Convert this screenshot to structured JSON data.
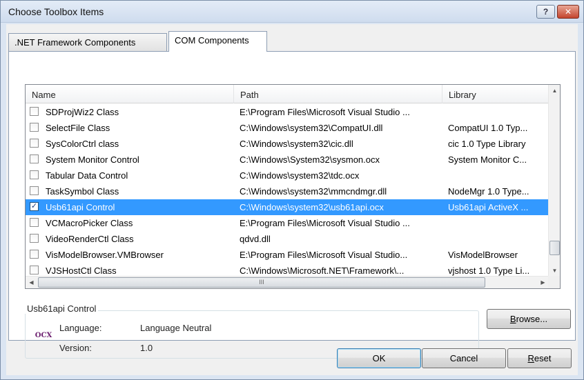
{
  "window": {
    "title": "Choose Toolbox Items",
    "help_button": "?",
    "close_button": "✕"
  },
  "tabs": [
    {
      "label": ".NET Framework Components",
      "active": false
    },
    {
      "label": "COM Components",
      "active": true
    }
  ],
  "columns": {
    "name": "Name",
    "path": "Path",
    "library": "Library"
  },
  "rows": [
    {
      "checked": false,
      "selected": false,
      "name": "SDProjWiz2 Class",
      "path": "E:\\Program Files\\Microsoft Visual Studio ...",
      "library": ""
    },
    {
      "checked": false,
      "selected": false,
      "name": "SelectFile Class",
      "path": "C:\\Windows\\system32\\CompatUI.dll",
      "library": "CompatUI 1.0 Typ..."
    },
    {
      "checked": false,
      "selected": false,
      "name": "SysColorCtrl class",
      "path": "C:\\Windows\\system32\\cic.dll",
      "library": "cic 1.0 Type Library"
    },
    {
      "checked": false,
      "selected": false,
      "name": "System Monitor Control",
      "path": "C:\\Windows\\System32\\sysmon.ocx",
      "library": "System Monitor C..."
    },
    {
      "checked": false,
      "selected": false,
      "name": "Tabular Data Control",
      "path": "C:\\Windows\\system32\\tdc.ocx",
      "library": ""
    },
    {
      "checked": false,
      "selected": false,
      "name": "TaskSymbol Class",
      "path": "C:\\Windows\\system32\\mmcndmgr.dll",
      "library": "NodeMgr 1.0 Type..."
    },
    {
      "checked": true,
      "selected": true,
      "name": "Usb61api Control",
      "path": "C:\\Windows\\system32\\usb61api.ocx",
      "library": "Usb61api ActiveX ..."
    },
    {
      "checked": false,
      "selected": false,
      "name": "VCMacroPicker Class",
      "path": "E:\\Program Files\\Microsoft Visual Studio ...",
      "library": ""
    },
    {
      "checked": false,
      "selected": false,
      "name": "VideoRenderCtl Class",
      "path": "qdvd.dll",
      "library": ""
    },
    {
      "checked": false,
      "selected": false,
      "name": "VisModelBrowser.VMBrowser",
      "path": "E:\\Program Files\\Microsoft Visual Studio...",
      "library": "VisModelBrowser"
    },
    {
      "checked": false,
      "selected": false,
      "name": "VJSHostCtl Class",
      "path": "C:\\Windows\\Microsoft.NET\\Framework\\...",
      "library": "vjshost 1.0 Type Li..."
    }
  ],
  "scroll": {
    "h_thumb_grip": "III"
  },
  "details": {
    "group_title": "Usb61api Control",
    "icon_text": "OCX",
    "language_label": "Language:",
    "language_value": "Language Neutral",
    "version_label": "Version:",
    "version_value": "1.0"
  },
  "buttons": {
    "browse_pre": "",
    "browse_accel": "B",
    "browse_post": "rowse...",
    "ok": "OK",
    "cancel": "Cancel",
    "reset_accel": "R",
    "reset_post": "eset"
  }
}
